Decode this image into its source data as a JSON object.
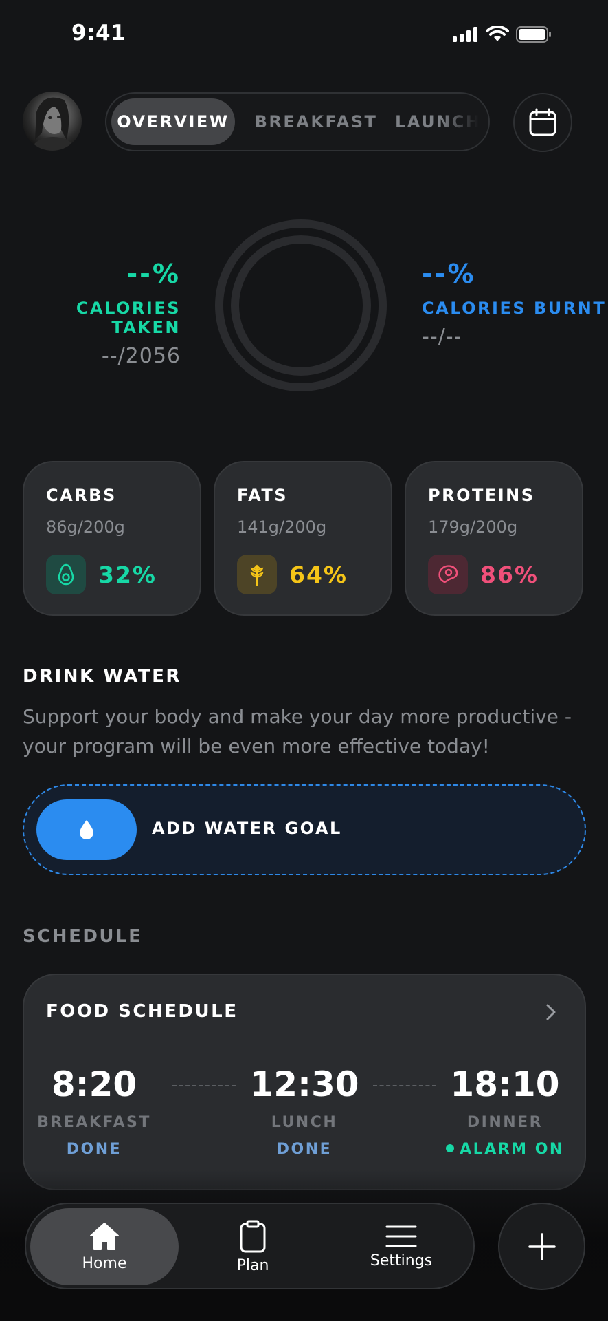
{
  "status_bar": {
    "time": "9:41",
    "icons": [
      "signal-icon",
      "wifi-icon",
      "battery-icon"
    ]
  },
  "header": {
    "tabs": [
      {
        "label": "OVERVIEW",
        "active": true
      },
      {
        "label": "BREAKFAST",
        "active": false
      },
      {
        "label": "LAUNCH",
        "active": false
      }
    ]
  },
  "calories": {
    "taken": {
      "percent": "--%",
      "label": "CALORIES TAKEN",
      "value": "--/2056",
      "color": "#17d8a6"
    },
    "burnt": {
      "percent": "--%",
      "label": "CALORIES BURNT",
      "value": "--/--",
      "color": "#2b8cf0"
    }
  },
  "macros": [
    {
      "title": "CARBS",
      "amount": "86g/200g",
      "percent": "32%",
      "icon": "avocado-icon",
      "color": "#17d8a6",
      "icon_bg": "#1f4a42"
    },
    {
      "title": "FATS",
      "amount": "141g/200g",
      "percent": "64%",
      "icon": "wheat-icon",
      "color": "#f5c518",
      "icon_bg": "#4d4426"
    },
    {
      "title": "PROTEINS",
      "amount": "179g/200g",
      "percent": "86%",
      "icon": "meat-icon",
      "color": "#f0507a",
      "icon_bg": "#4d2833"
    }
  ],
  "water": {
    "title": "DRINK WATER",
    "description": "Support your body and make your day more productive - your program will be even more effective today!",
    "button_label": "ADD WATER GOAL"
  },
  "schedule": {
    "section_title": "SCHEDULE",
    "card_title": "FOOD SCHEDULE",
    "meals": [
      {
        "time": "8:20",
        "name": "BREAKFAST",
        "status": "DONE"
      },
      {
        "time": "12:30",
        "name": "LUNCH",
        "status": "DONE"
      },
      {
        "time": "18:10",
        "name": "DINNER",
        "status": "ALARM ON"
      }
    ]
  },
  "nav": {
    "items": [
      {
        "label": "Home",
        "active": true
      },
      {
        "label": "Plan",
        "active": false
      },
      {
        "label": "Settings",
        "active": false
      }
    ]
  }
}
